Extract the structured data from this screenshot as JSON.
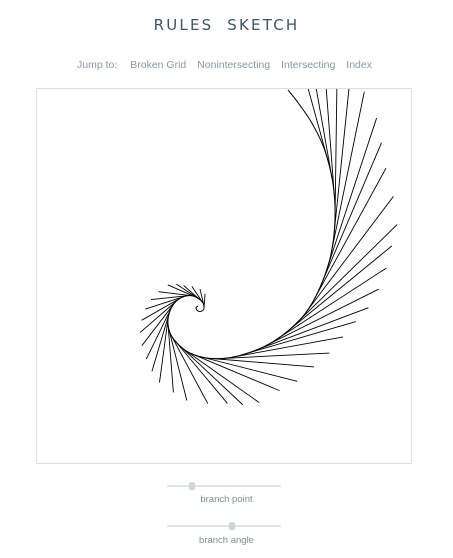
{
  "page": {
    "title": "RULES  SKETCH"
  },
  "nav": {
    "lead": "Jump to:",
    "links": [
      "Broken Grid",
      "Nonintersecting",
      "Intersecting",
      "Index"
    ]
  },
  "sliders": [
    {
      "label": "branch point",
      "value": 0.22
    },
    {
      "label": "branch angle",
      "value": 0.57
    }
  ],
  "colors": {
    "title": "#3f5661",
    "text": "#7b8a93",
    "stroke": "#000000",
    "border": "#dedede",
    "track": "#dfe3e5"
  }
}
